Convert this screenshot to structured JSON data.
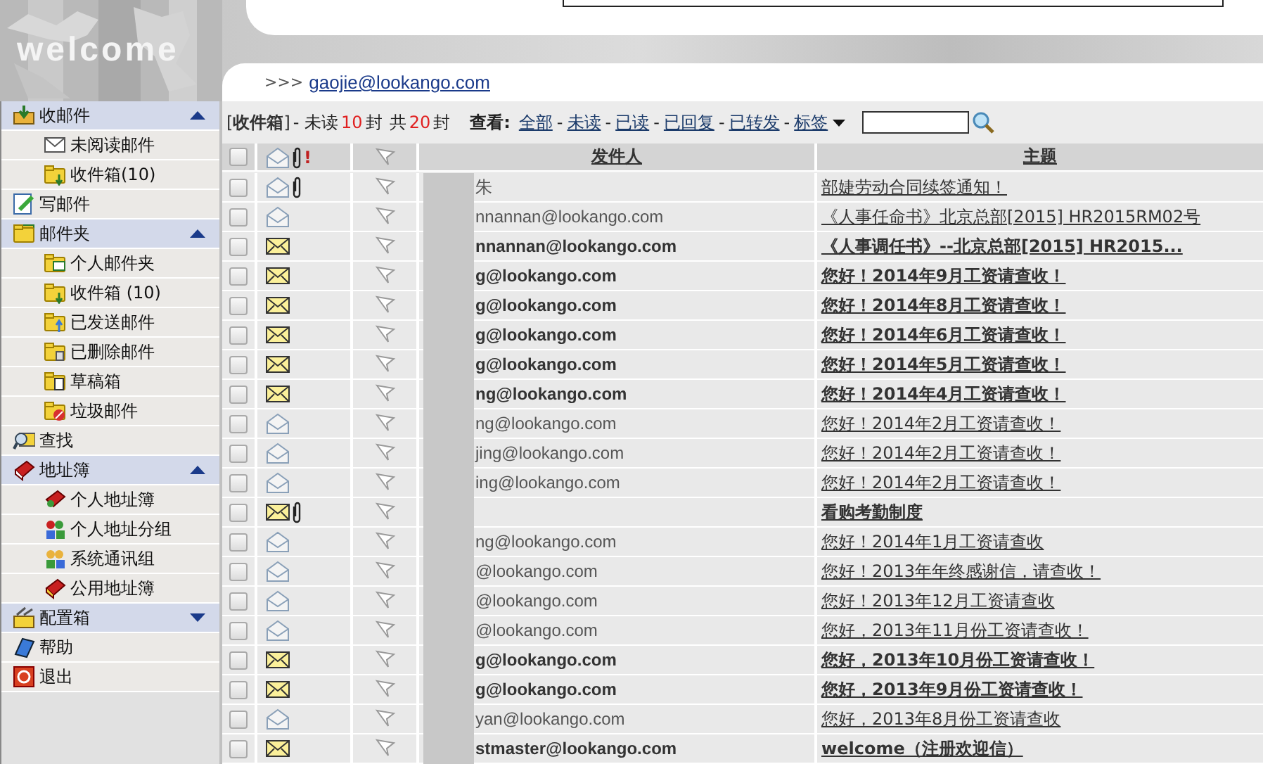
{
  "banner": {
    "title": "welcome"
  },
  "account": {
    "prefix": ">>>",
    "email": "gaojie@lookango.com"
  },
  "sidebar": {
    "items": [
      {
        "kind": "section",
        "label": "收邮件",
        "expanded": true,
        "children": [
          {
            "kind": "link",
            "label": "未阅读邮件"
          },
          {
            "kind": "link",
            "label": "收件箱(10)"
          }
        ]
      },
      {
        "kind": "link",
        "label": "写邮件"
      },
      {
        "kind": "section",
        "label": "邮件夹",
        "expanded": true,
        "children": [
          {
            "kind": "link",
            "label": "个人邮件夹"
          },
          {
            "kind": "link",
            "label": "收件箱 (10)"
          },
          {
            "kind": "link",
            "label": "已发送邮件"
          },
          {
            "kind": "link",
            "label": "已删除邮件"
          },
          {
            "kind": "link",
            "label": "草稿箱"
          },
          {
            "kind": "link",
            "label": "垃圾邮件"
          }
        ]
      },
      {
        "kind": "link",
        "label": "查找"
      },
      {
        "kind": "section",
        "label": "地址簿",
        "expanded": true,
        "children": [
          {
            "kind": "link",
            "label": "个人地址簿"
          },
          {
            "kind": "link",
            "label": "个人地址分组"
          },
          {
            "kind": "link",
            "label": "系统通讯组"
          },
          {
            "kind": "link",
            "label": "公用地址簿"
          }
        ]
      },
      {
        "kind": "section",
        "label": "配置箱",
        "expanded": false
      },
      {
        "kind": "link",
        "label": "帮助"
      },
      {
        "kind": "link",
        "label": "退出"
      }
    ]
  },
  "toolbar": {
    "folder": "[**收件箱**]",
    "unread_label": "- 未读",
    "unread": "10",
    "unit": "封",
    "total_label": "共",
    "total": "20",
    "total_unit": "封",
    "view_label": "查看:",
    "separator": "-",
    "filters": [
      {
        "label": "全部",
        "dropdown": false
      },
      {
        "label": "未读",
        "dropdown": false
      },
      {
        "label": "已读",
        "dropdown": false
      },
      {
        "label": "已回复",
        "dropdown": false
      },
      {
        "label": "已转发",
        "dropdown": false
      },
      {
        "label": "标签",
        "dropdown": true
      }
    ]
  },
  "table": {
    "columns": [
      "发件人",
      "主题"
    ],
    "header_checked": false,
    "header_priority": "!",
    "rows": [
      {
        "unread": false,
        "attachment": true,
        "checked": false,
        "sender": "朱",
        "subject": "部婕劳动合同续签通知！"
      },
      {
        "unread": false,
        "attachment": false,
        "checked": false,
        "sender": "nnannan@lookango.com",
        "subject": "《人事任命书》北京总部[2015] HR2015RM02号"
      },
      {
        "unread": true,
        "attachment": false,
        "checked": false,
        "sender": "nnannan@lookango.com",
        "subject": "《人事调任书》--北京总部[2015] HR2015..."
      },
      {
        "unread": true,
        "attachment": false,
        "checked": false,
        "sender": "g@lookango.com",
        "subject": "您好！2014年9月工资请查收！"
      },
      {
        "unread": true,
        "attachment": false,
        "checked": false,
        "sender": "g@lookango.com",
        "subject": "您好！2014年8月工资请查收！"
      },
      {
        "unread": true,
        "attachment": false,
        "checked": false,
        "sender": "g@lookango.com",
        "subject": "您好！2014年6月工资请查收！"
      },
      {
        "unread": true,
        "attachment": false,
        "checked": false,
        "sender": "g@lookango.com",
        "subject": "您好！2014年5月工资请查收！"
      },
      {
        "unread": true,
        "attachment": false,
        "checked": false,
        "sender": "ng@lookango.com",
        "subject": "您好！2014年4月工资请查收！"
      },
      {
        "unread": false,
        "attachment": false,
        "checked": false,
        "sender": "ng@lookango.com",
        "subject": "您好！2014年2月工资请查收！"
      },
      {
        "unread": false,
        "attachment": false,
        "checked": false,
        "sender": "jing@lookango.com",
        "subject": "您好！2014年2月工资请查收！"
      },
      {
        "unread": false,
        "attachment": false,
        "checked": false,
        "sender": "ing@lookango.com",
        "subject": "您好！2014年2月工资请查收！"
      },
      {
        "unread": true,
        "attachment": true,
        "checked": false,
        "subject": "看购考勤制度"
      },
      {
        "unread": false,
        "attachment": false,
        "checked": false,
        "sender": "ng@lookango.com",
        "subject": "您好！2014年1月工资请查收"
      },
      {
        "unread": false,
        "attachment": false,
        "checked": false,
        "sender": "@lookango.com",
        "subject": "您好！2013年年终感谢信，请查收！"
      },
      {
        "unread": false,
        "attachment": false,
        "checked": false,
        "sender": "@lookango.com",
        "subject": "您好！2013年12月工资请查收"
      },
      {
        "unread": false,
        "attachment": false,
        "checked": false,
        "sender": "@lookango.com",
        "subject": "您好，2013年11月份工资请查收！"
      },
      {
        "unread": true,
        "attachment": false,
        "checked": false,
        "sender": "g@lookango.com",
        "subject": "您好，2013年10月份工资请查收！"
      },
      {
        "unread": true,
        "attachment": false,
        "checked": false,
        "sender": "g@lookango.com",
        "subject": "您好，2013年9月份工资请查收！"
      },
      {
        "unread": false,
        "attachment": false,
        "checked": false,
        "sender": "yan@lookango.com",
        "subject": "您好，2013年8月份工资请查收"
      },
      {
        "unread": true,
        "attachment": false,
        "checked": false,
        "sender": "stmaster@lookango.com",
        "subject": "welcome（注册欢迎信）"
      }
    ]
  }
}
